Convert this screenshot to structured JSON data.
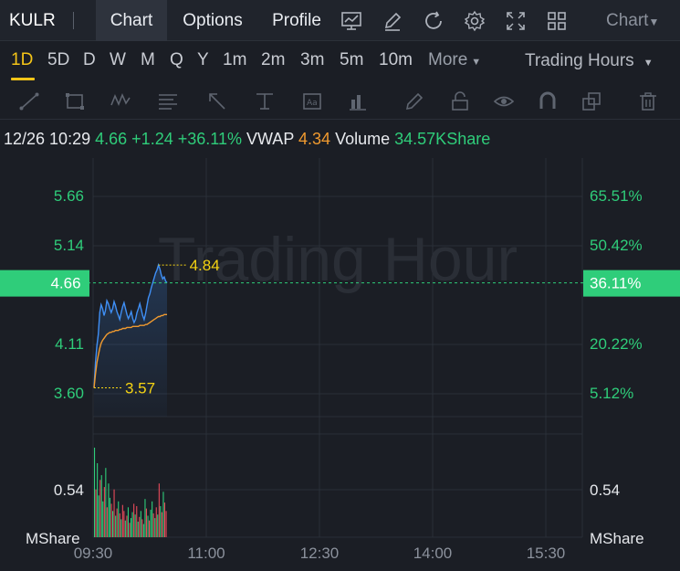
{
  "header": {
    "ticker": "KULR",
    "tabs": [
      {
        "label": "Chart",
        "active": true
      },
      {
        "label": "Options",
        "active": false
      },
      {
        "label": "Profile",
        "active": false
      }
    ],
    "icons": [
      "chart-line-icon",
      "edit-icon",
      "refresh-icon",
      "settings-gear-icon",
      "fullscreen-icon",
      "grid-layout-icon"
    ],
    "chart_select": "Chart"
  },
  "periods": {
    "items": [
      "1D",
      "5D",
      "D",
      "W",
      "M",
      "Q",
      "Y",
      "1m",
      "2m",
      "3m",
      "5m",
      "10m",
      "More"
    ],
    "active": "1D",
    "session": "Trading Hours"
  },
  "drawing_tools": [
    "trend-line-icon",
    "rectangle-icon",
    "wave-icon",
    "fib-icon",
    "arrow-icon",
    "price-range-icon",
    "text-note-icon",
    "bar-pattern-icon",
    "pen-icon",
    "lock-icon",
    "eye-icon",
    "magnet-icon",
    "layers-icon",
    "trash-icon"
  ],
  "quote": {
    "datetime": "12/26 10:29",
    "price": "4.66",
    "change": "+1.24",
    "change_pct": "+36.11%",
    "vwap_label": "VWAP",
    "vwap": "4.34",
    "volume_label": "Volume",
    "volume": "34.57KShare"
  },
  "colors": {
    "up": "#2fcd7a",
    "down": "#e84a5a",
    "price_line": "#3f8ff5",
    "vwap_line": "#f09a2f",
    "annotation": "#f5d313",
    "grid": "#2a2f38"
  },
  "chart_data": {
    "type": "line",
    "watermark": "Trading Hour",
    "price_axis_left": [
      "5.66",
      "5.14",
      "4.11",
      "3.60"
    ],
    "price_axis_right": [
      "65.51%",
      "50.42%",
      "20.22%",
      "5.12%"
    ],
    "current_price_tag": "4.66",
    "current_pct_tag": "36.11%",
    "high_label": "4.84",
    "low_label": "3.57",
    "volume_axis_left": "0.54",
    "volume_axis_right": "0.54",
    "volume_unit_left": "MShare",
    "volume_unit_right": "MShare",
    "x_ticks": [
      "09:30",
      "11:00",
      "12:30",
      "14:00",
      "15:30"
    ],
    "ylim": [
      3.31,
      5.92
    ],
    "price": [
      3.6,
      3.86,
      4.02,
      4.14,
      4.36,
      4.44,
      4.4,
      4.33,
      4.38,
      4.48,
      4.45,
      4.4,
      4.36,
      4.4,
      4.47,
      4.43,
      4.37,
      4.33,
      4.29,
      4.36,
      4.42,
      4.46,
      4.4,
      4.34,
      4.3,
      4.33,
      4.37,
      4.3,
      4.26,
      4.29,
      4.36,
      4.4,
      4.45,
      4.39,
      4.33,
      4.29,
      4.35,
      4.43,
      4.51,
      4.55,
      4.61,
      4.66,
      4.71,
      4.76,
      4.79,
      4.84,
      4.8,
      4.74,
      4.7,
      4.72,
      4.68,
      4.66
    ],
    "vwap": [
      3.6,
      3.74,
      3.85,
      3.93,
      4.0,
      4.05,
      4.08,
      4.1,
      4.12,
      4.14,
      4.15,
      4.16,
      4.16,
      4.17,
      4.17,
      4.18,
      4.18,
      4.18,
      4.19,
      4.19,
      4.2,
      4.2,
      4.2,
      4.21,
      4.21,
      4.21,
      4.21,
      4.22,
      4.22,
      4.22,
      4.22,
      4.22,
      4.23,
      4.23,
      4.23,
      4.23,
      4.24,
      4.24,
      4.25,
      4.26,
      4.27,
      4.28,
      4.29,
      4.3,
      4.31,
      4.32,
      4.32,
      4.33,
      4.33,
      4.34,
      4.34,
      4.34
    ],
    "volume_max": 0.75,
    "volume": [
      0.75,
      0.4,
      0.62,
      0.35,
      0.48,
      0.52,
      0.3,
      0.42,
      0.58,
      0.25,
      0.45,
      0.33,
      0.28,
      0.22,
      0.4,
      0.18,
      0.24,
      0.3,
      0.2,
      0.15,
      0.27,
      0.22,
      0.14,
      0.18,
      0.25,
      0.12,
      0.16,
      0.21,
      0.28,
      0.19,
      0.26,
      0.13,
      0.17,
      0.22,
      0.15,
      0.11,
      0.32,
      0.24,
      0.18,
      0.14,
      0.23,
      0.3,
      0.2,
      0.16,
      0.25,
      0.19,
      0.45,
      0.26,
      0.21,
      0.38,
      0.29,
      0.22
    ],
    "volume_dir": [
      "u",
      "d",
      "u",
      "u",
      "d",
      "u",
      "u",
      "d",
      "u",
      "d",
      "u",
      "u",
      "d",
      "u",
      "d",
      "u",
      "d",
      "u",
      "d",
      "u",
      "d",
      "d",
      "u",
      "d",
      "u",
      "d",
      "u",
      "u",
      "d",
      "u",
      "d",
      "u",
      "d",
      "u",
      "d",
      "u",
      "u",
      "d",
      "u",
      "d",
      "u",
      "u",
      "d",
      "u",
      "d",
      "u",
      "d",
      "u",
      "d",
      "u",
      "d",
      "d"
    ]
  }
}
